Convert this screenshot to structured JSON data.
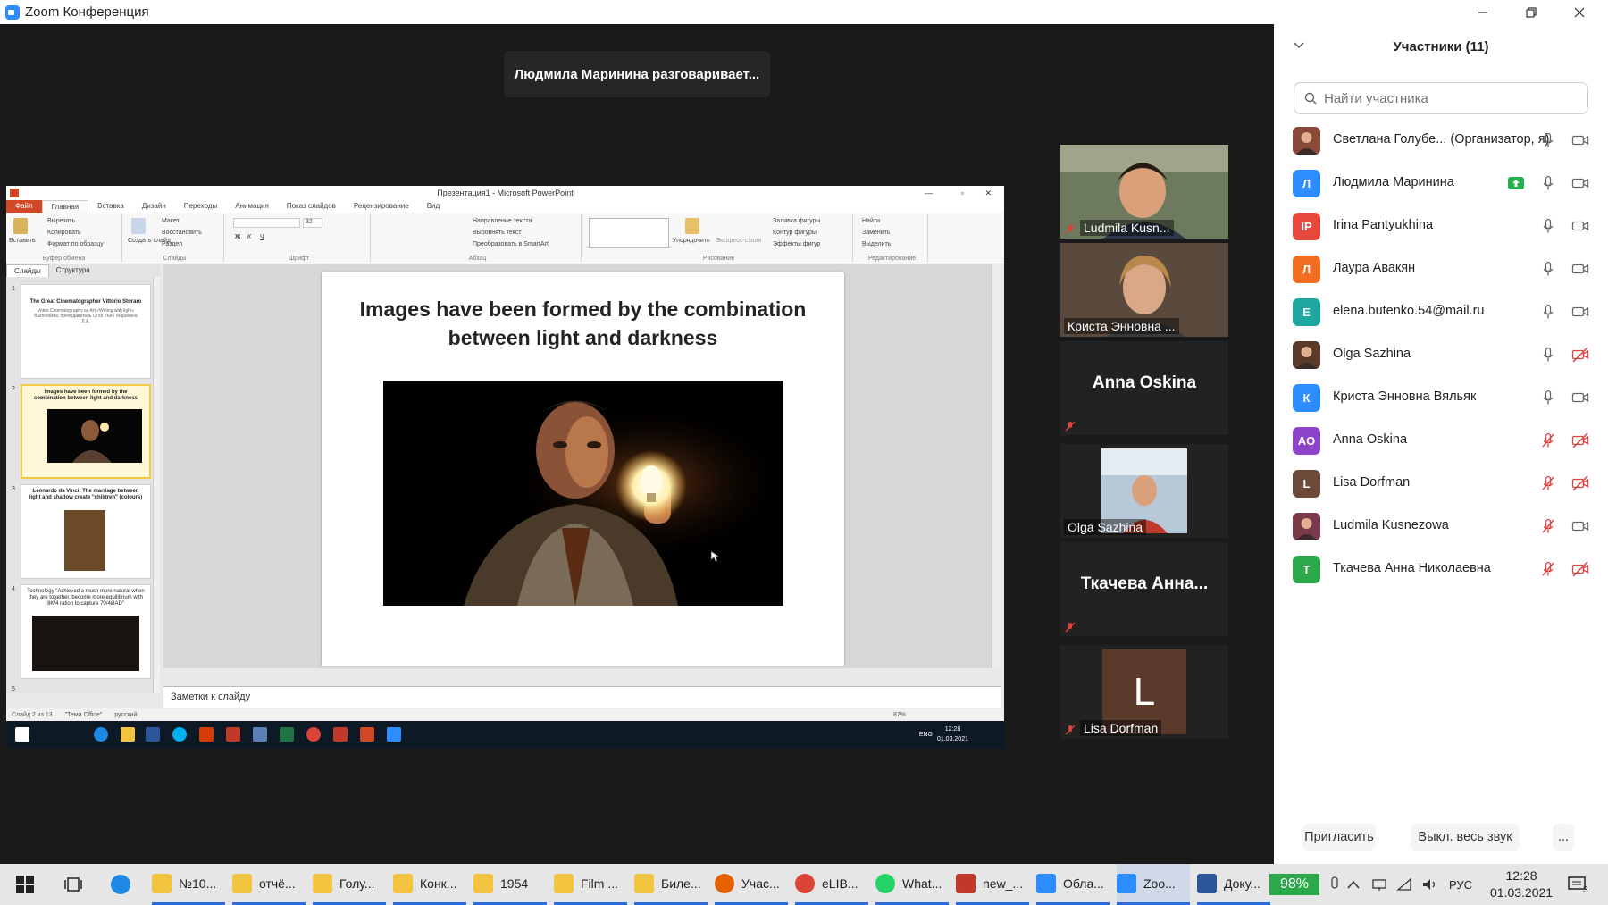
{
  "window": {
    "title": "Zoom Конференция"
  },
  "speaking_banner": "Людмила Маринина разговаривает...",
  "ppt": {
    "window_title": "Презентация1 - Microsoft PowerPoint",
    "tabs": [
      "Файл",
      "Главная",
      "Вставка",
      "Дизайн",
      "Переходы",
      "Анимация",
      "Показ слайдов",
      "Рецензирование",
      "Вид"
    ],
    "ribbon_groups": [
      "Буфер обмена",
      "Слайды",
      "Шрифт",
      "Абзац",
      "Рисование",
      "Редактирование"
    ],
    "ribbon_items": {
      "paste": "Вставить",
      "cut": "Вырезать",
      "copy": "Копировать",
      "format_painter": "Формат по образцу",
      "new_slide": "Создать слайд",
      "layout": "Макет",
      "reset": "Восстановить",
      "section": "Раздел",
      "text_direction": "Направление текста",
      "align_text": "Выровнять текст",
      "smartart": "Преобразовать в SmartArt",
      "arrange": "Упорядочить",
      "quick_styles": "Экспресс-стили",
      "shape_fill": "Заливка фигуры",
      "shape_outline": "Контур фигуры",
      "shape_effects": "Эффекты фигур",
      "find": "Найти",
      "replace": "Заменить",
      "select": "Выделить",
      "font_size": "32"
    },
    "pane_tabs": [
      "Слайды",
      "Структура"
    ],
    "thumbnails": [
      {
        "num": "1",
        "title": "The Great Cinematographer Vittorio Storaro",
        "sub": "Video Cinematography as Art «Writing with light» Выполнила: преподаватель СПбГУКиТ Маринина Л.А."
      },
      {
        "num": "2",
        "title": "Images have been formed by the combination between light and darkness",
        "sub": ""
      },
      {
        "num": "3",
        "title": "Leonardo da Vinci: The marriage between light and shadow create \"children\" (colours)",
        "sub": ""
      },
      {
        "num": "4",
        "title": "Technology \"Achieved a much more natural when they are together, become more equilibrium with 8K/4 ration to capture 70/4ØAD\"",
        "sub": ""
      },
      {
        "num": "5",
        "title": "",
        "sub": ""
      }
    ],
    "slide_title": "Images have been formed by the combination between light and darkness",
    "notes_placeholder": "Заметки к слайду",
    "status": {
      "slide": "Слайд 2 из 13",
      "theme": "\"Тема Office\"",
      "lang": "русский",
      "zoom": "87%"
    },
    "inner_clock": {
      "time": "12:28",
      "date": "01.03.2021",
      "lang": "ENG"
    }
  },
  "video_tiles": [
    {
      "name": "Ludmila Kusn...",
      "type": "video",
      "muted": true
    },
    {
      "name": "Криста Энновна ...",
      "type": "video",
      "muted": false
    },
    {
      "name": "Anna Oskina",
      "type": "name",
      "muted": true
    },
    {
      "name": "Olga Sazhina",
      "type": "video",
      "muted": false
    },
    {
      "name": "Ткачева Анна...",
      "type": "name",
      "muted": true
    },
    {
      "name": "Lisa Dorfman",
      "type": "avatar",
      "letter": "L",
      "muted": true
    }
  ],
  "participants_panel": {
    "title": "Участники (11)",
    "search_placeholder": "Найти участника",
    "participants": [
      {
        "name": "Светлана Голубе... (Организатор, я)",
        "avatar_text": "",
        "avatar_color": "#8a4a3a",
        "mic": "on",
        "video": "on",
        "share": false
      },
      {
        "name": "Людмила Маринина",
        "avatar_text": "Л",
        "avatar_color": "#2d8cff",
        "mic": "on",
        "video": "on",
        "share": true
      },
      {
        "name": "Irina Pantyukhina",
        "avatar_text": "IP",
        "avatar_color": "#e8483c",
        "mic": "on",
        "video": "on",
        "share": false
      },
      {
        "name": "Лаура Авакян",
        "avatar_text": "Л",
        "avatar_color": "#f26d21",
        "mic": "on",
        "video": "on",
        "share": false
      },
      {
        "name": "elena.butenko.54@mail.ru",
        "avatar_text": "E",
        "avatar_color": "#1ea7a0",
        "mic": "on",
        "video": "on",
        "share": false
      },
      {
        "name": "Olga Sazhina",
        "avatar_text": "",
        "avatar_color": "#5a3b2a",
        "mic": "on",
        "video": "off",
        "share": false
      },
      {
        "name": "Криста Энновна Вяльяк",
        "avatar_text": "К",
        "avatar_color": "#2d8cff",
        "mic": "on",
        "video": "on",
        "share": false
      },
      {
        "name": "Anna Oskina",
        "avatar_text": "AO",
        "avatar_color": "#8e44c8",
        "mic": "off",
        "video": "off",
        "share": false
      },
      {
        "name": "Lisa Dorfman",
        "avatar_text": "L",
        "avatar_color": "#6b4a3a",
        "mic": "off",
        "video": "off",
        "share": false
      },
      {
        "name": "Ludmila Kusnezowa",
        "avatar_text": "",
        "avatar_color": "#7a3a4a",
        "mic": "off",
        "video": "on",
        "share": false
      },
      {
        "name": "Ткачева Анна Николаевна",
        "avatar_text": "Т",
        "avatar_color": "#2aa84a",
        "mic": "off",
        "video": "off",
        "share": false
      }
    ],
    "invite_label": "Пригласить",
    "mute_all_label": "Выкл. весь звук",
    "more_label": "..."
  },
  "taskbar": {
    "items": [
      {
        "label": "№10...",
        "icon": "folder"
      },
      {
        "label": "отчё...",
        "icon": "folder"
      },
      {
        "label": "Голу...",
        "icon": "folder"
      },
      {
        "label": "Конк...",
        "icon": "folder"
      },
      {
        "label": "1954",
        "icon": "folder"
      },
      {
        "label": "Film ...",
        "icon": "folder"
      },
      {
        "label": "Биле...",
        "icon": "folder"
      },
      {
        "label": "Учас...",
        "icon": "firefox"
      },
      {
        "label": "eLIB...",
        "icon": "chrome"
      },
      {
        "label": "What...",
        "icon": "whatsapp"
      },
      {
        "label": "new_...",
        "icon": "pdf"
      },
      {
        "label": "Обла...",
        "icon": "zoom"
      },
      {
        "label": "Zoo...",
        "icon": "zoom"
      },
      {
        "label": "Доку...",
        "icon": "word"
      }
    ],
    "battery": "98%",
    "lang": "РУС",
    "time": "12:28",
    "date": "01.03.2021",
    "notification_count": "3"
  },
  "colors": {
    "zoom_blue": "#2d8cff",
    "red_muted": "#e0403a",
    "share_green": "#23b14d"
  }
}
